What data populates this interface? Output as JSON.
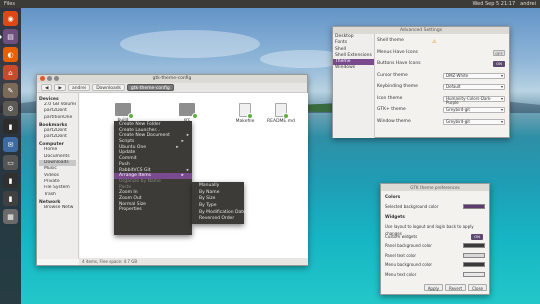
{
  "colors": {
    "accent": "#7a4a8e",
    "panel": "#3c3b37",
    "launcher_bg": "#28242c"
  },
  "topbar": {
    "title": "Files",
    "indicators": [
      "Wed Sep 5 21:17",
      "andrei"
    ]
  },
  "launcher": {
    "icons": [
      "ubuntu-icon",
      "files-icon",
      "firefox-icon",
      "store-icon",
      "text-editor-icon",
      "settings-icon",
      "terminal-icon",
      "mail-icon",
      "monitor-icon",
      "terminal-icon",
      "terminal-icon",
      "system-icon"
    ]
  },
  "file_manager": {
    "title": "gtk-theme-config",
    "breadcrumb": [
      "andrei",
      "Downloads",
      "gtk-theme-config"
    ],
    "sidebar": [
      {
        "header": "Devices",
        "items": [
          "2.0 GB Volume",
          "part2Dont",
          "partitionOne"
        ]
      },
      {
        "header": "Bookmarks",
        "items": [
          "part2Dont",
          "part2Dont"
        ]
      },
      {
        "header": "Computer",
        "items": [
          "Home",
          "Documents",
          "Downloads",
          "Music",
          "Videos",
          "Private",
          "File System",
          "Trash"
        ]
      },
      {
        "header": "Network",
        "items": [
          "Browse Netw"
        ]
      }
    ],
    "files": [
      {
        "name": "build",
        "type": "folder"
      },
      {
        "name": "src",
        "type": "folder"
      },
      {
        "name": "Makefile",
        "type": "doc"
      },
      {
        "name": "README.md",
        "type": "doc"
      }
    ],
    "status": "4 items, Free space: 4.7 GB"
  },
  "context_menu": {
    "items": [
      {
        "label": "Create New Folder",
        "state": "normal"
      },
      {
        "label": "Create Launcher...",
        "state": "normal"
      },
      {
        "label": "Create New Document",
        "state": "normal",
        "arrow": true
      },
      {
        "label": "Scripts",
        "state": "normal",
        "arrow": true
      },
      {
        "label": "Ubuntu One",
        "state": "normal",
        "arrow": true
      },
      {
        "label": "Update",
        "state": "normal"
      },
      {
        "label": "Commit",
        "state": "normal"
      },
      {
        "label": "Push",
        "state": "normal"
      },
      {
        "label": "RabbitVCS Git",
        "state": "normal",
        "arrow": true
      },
      {
        "label": "Arrange Items",
        "state": "highlight",
        "arrow": true
      },
      {
        "label": "Organize by Name",
        "state": "disabled"
      },
      {
        "label": "Paste",
        "state": "disabled"
      },
      {
        "label": "Zoom In",
        "state": "normal"
      },
      {
        "label": "Zoom Out",
        "state": "normal"
      },
      {
        "label": "Normal Size",
        "state": "normal"
      },
      {
        "label": "Properties",
        "state": "normal"
      }
    ],
    "submenu": [
      "Manually",
      "By Name",
      "By Size",
      "By Type",
      "By Modification Date",
      "Reversed Order"
    ]
  },
  "settings": {
    "title": "Advanced Settings",
    "sidebar": [
      "Desktop",
      "Fonts",
      "Shell",
      "Shell Extensions",
      "Theme",
      "Windows"
    ],
    "selected": "Theme",
    "rows": [
      {
        "label": "Shell theme",
        "kind": "warn",
        "value": ""
      },
      {
        "label": "Menus Have Icons",
        "kind": "toggle",
        "value": "OFF"
      },
      {
        "label": "Buttons Have Icons",
        "kind": "toggle",
        "value": "ON"
      },
      {
        "label": "Cursor theme",
        "kind": "combo",
        "value": "DMZ-White"
      },
      {
        "label": "Keybinding theme",
        "kind": "combo",
        "value": "Default"
      },
      {
        "label": "Icon theme",
        "kind": "combo",
        "value": "Humanity-Colors-Dark-Purple"
      },
      {
        "label": "GTK+ theme",
        "kind": "combo",
        "value": "Greybird-git"
      },
      {
        "label": "Window theme",
        "kind": "combo",
        "value": "Greybird-git"
      }
    ]
  },
  "prefs": {
    "title": "GTK theme preferences",
    "sections": [
      {
        "header": "Colors",
        "rows": [
          {
            "label": "Selected background color",
            "swatch": "#5e3b6e"
          }
        ]
      },
      {
        "header": "Widgets",
        "rows": [
          {
            "label": "Use layout to logout and login back to apply changes",
            "swatch": ""
          },
          {
            "label": "Custom widgets",
            "toggle": "ON"
          },
          {
            "label": "Panel background color",
            "swatch": "#3a3a3a"
          },
          {
            "label": "Panel text color",
            "swatch": "#d9d9d9"
          },
          {
            "label": "Menu background color",
            "swatch": "#3a3a3a"
          },
          {
            "label": "Menu text color",
            "swatch": "#e8e8e8"
          }
        ]
      }
    ],
    "buttons": [
      "Apply",
      "Revert",
      "Close"
    ]
  }
}
